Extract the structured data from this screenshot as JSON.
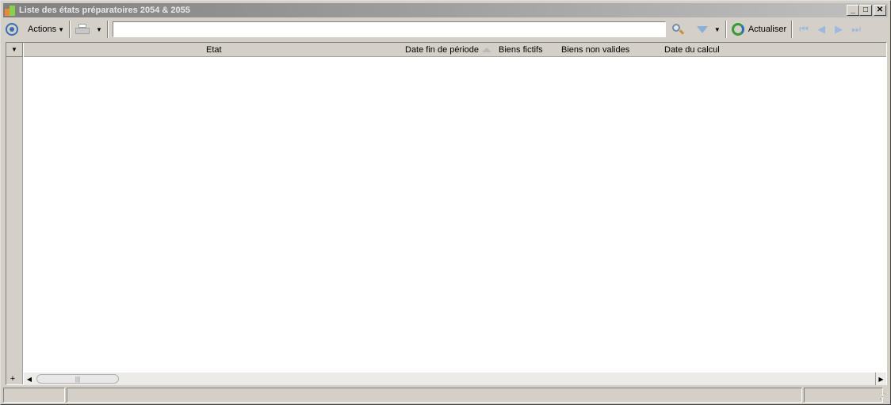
{
  "window": {
    "title": "Liste des états préparatoires 2054 & 2055",
    "controls": {
      "minimize": "_",
      "maximize": "□",
      "close": "✕"
    }
  },
  "toolbar": {
    "actions_label": "Actions",
    "search": {
      "value": "",
      "placeholder": ""
    },
    "refresh_label": "Actualiser"
  },
  "grid": {
    "columns": [
      "Etat",
      "Date fin de période",
      "Biens fictifs",
      "Biens non valides",
      "Date du calcul"
    ],
    "sorted_column": "Date fin de période",
    "sort_direction": "ascending",
    "rows": []
  },
  "icons": {
    "menu_circle": "circle-target-icon",
    "printer": "printer-icon",
    "search": "magnifier-icon",
    "filter": "funnel-icon",
    "refresh": "refresh-icon",
    "nav": [
      "first-page-icon",
      "previous-page-icon",
      "next-page-icon",
      "last-page-icon"
    ]
  },
  "colors": {
    "title_gradient_start": "#808080",
    "title_gradient_end": "#c0c0c0",
    "chrome": "#d4d0c8",
    "accent_blue": "#3a6fb8",
    "refresh_green": "#3a9a3a"
  },
  "statusbar": {
    "cells": [
      "",
      "",
      ""
    ]
  }
}
